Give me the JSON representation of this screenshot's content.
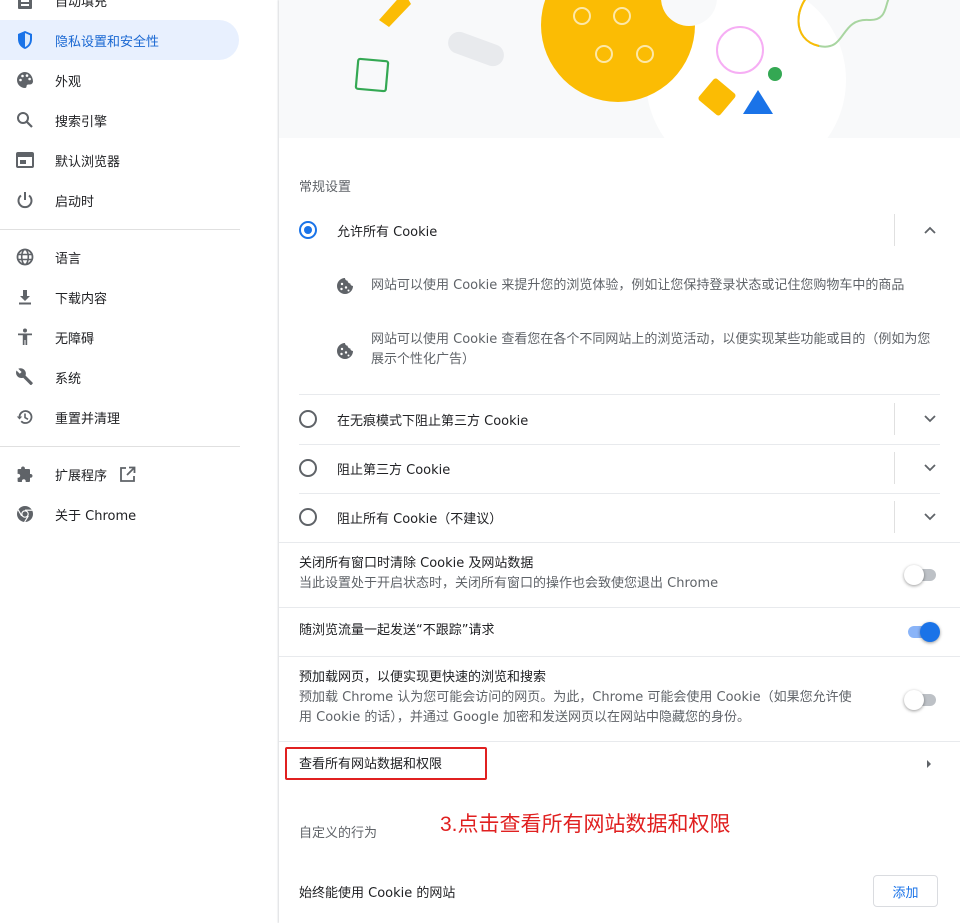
{
  "sidebar": {
    "items": [
      {
        "label": "自动填充",
        "icon": "autofill-icon"
      },
      {
        "label": "隐私设置和安全性",
        "icon": "shield-icon",
        "active": true
      },
      {
        "label": "外观",
        "icon": "palette-icon"
      },
      {
        "label": "搜索引擎",
        "icon": "search-icon"
      },
      {
        "label": "默认浏览器",
        "icon": "browser-icon"
      },
      {
        "label": "启动时",
        "icon": "power-icon"
      },
      {
        "label": "语言",
        "icon": "globe-icon"
      },
      {
        "label": "下载内容",
        "icon": "download-icon"
      },
      {
        "label": "无障碍",
        "icon": "accessibility-icon"
      },
      {
        "label": "系统",
        "icon": "wrench-icon"
      },
      {
        "label": "重置并清理",
        "icon": "restore-icon"
      },
      {
        "label": "扩展程序",
        "icon": "puzzle-icon"
      },
      {
        "label": "关于 Chrome",
        "icon": "chrome-icon"
      }
    ]
  },
  "general": {
    "title": "常规设置",
    "allow_all": "允许所有 Cookie",
    "allow_all_detail_1": "网站可以使用 Cookie 来提升您的浏览体验，例如让您保持登录状态或记住您购物车中的商品",
    "allow_all_detail_2": "网站可以使用 Cookie 查看您在各个不同网站上的浏览活动，以便实现某些功能或目的（例如为您展示个性化广告）",
    "block_incognito": "在无痕模式下阻止第三方 Cookie",
    "block_third_party": "阻止第三方 Cookie",
    "block_all": "阻止所有 Cookie（不建议）"
  },
  "toggles": {
    "clear_on_exit": {
      "label": "关闭所有窗口时清除 Cookie 及网站数据",
      "sub": "当此设置处于开启状态时，关闭所有窗口的操作也会致使您退出 Chrome",
      "on": false
    },
    "do_not_track": {
      "label": "随浏览流量一起发送“不跟踪”请求",
      "on": true
    },
    "preload": {
      "label": "预加载网页，以便实现更快速的浏览和搜索",
      "sub": "预加载 Chrome 认为您可能会访问的网页。为此，Chrome 可能会使用 Cookie（如果您允许使用 Cookie 的话），并通过 Google 加密和发送网页以在网站中隐藏您的身份。",
      "on": false
    }
  },
  "view_all": {
    "label": "查看所有网站数据和权限"
  },
  "annotation": "3.点击查看所有网站数据和权限",
  "custom": {
    "title": "自定义的行为",
    "always_allow": "始终能使用 Cookie 的网站",
    "add_button": "添加"
  },
  "colors": {
    "accent": "#1a73e8",
    "annotation": "#e02020",
    "active_nav_bg": "#e8f0fe"
  }
}
